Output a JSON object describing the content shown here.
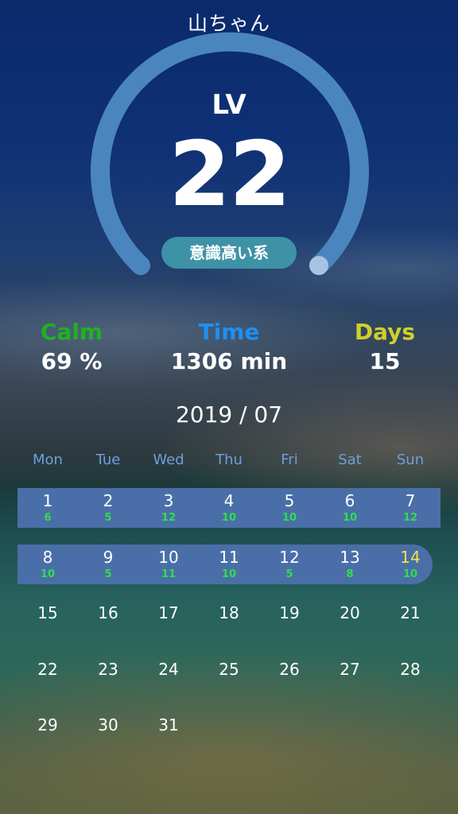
{
  "header": {
    "title": "山ちゃん"
  },
  "level": {
    "label": "LV",
    "value": "22",
    "rank": "意識高い系",
    "progress": 0.95
  },
  "colors": {
    "calm": "#1fb21f",
    "time": "#1c8ff5",
    "days": "#cfcf2c",
    "gauge_track": "#4a86bd",
    "gauge_knob": "#a9c2e2",
    "highlight_row": "#4a6fa8",
    "today": "#f1e44a",
    "session_count": "#2ee04a"
  },
  "stats": {
    "calm": {
      "label": "Calm",
      "value": "69 %"
    },
    "time": {
      "label": "Time",
      "value": "1306 min"
    },
    "days": {
      "label": "Days",
      "value": "15"
    }
  },
  "calendar": {
    "month_label": "2019 / 07",
    "weekdays": [
      "Mon",
      "Tue",
      "Wed",
      "Thu",
      "Fri",
      "Sat",
      "Sun"
    ],
    "weeks": [
      [
        {
          "day": "1",
          "count": "6"
        },
        {
          "day": "2",
          "count": "5"
        },
        {
          "day": "3",
          "count": "12"
        },
        {
          "day": "4",
          "count": "10"
        },
        {
          "day": "5",
          "count": "10"
        },
        {
          "day": "6",
          "count": "10"
        },
        {
          "day": "7",
          "count": "12"
        }
      ],
      [
        {
          "day": "8",
          "count": "10"
        },
        {
          "day": "9",
          "count": "5"
        },
        {
          "day": "10",
          "count": "11"
        },
        {
          "day": "11",
          "count": "10"
        },
        {
          "day": "12",
          "count": "5"
        },
        {
          "day": "13",
          "count": "8"
        },
        {
          "day": "14",
          "count": "10",
          "today": true
        }
      ],
      [
        {
          "day": "15"
        },
        {
          "day": "16"
        },
        {
          "day": "17"
        },
        {
          "day": "18"
        },
        {
          "day": "19"
        },
        {
          "day": "20"
        },
        {
          "day": "21"
        }
      ],
      [
        {
          "day": "22"
        },
        {
          "day": "23"
        },
        {
          "day": "24"
        },
        {
          "day": "25"
        },
        {
          "day": "26"
        },
        {
          "day": "27"
        },
        {
          "day": "28"
        }
      ],
      [
        {
          "day": "29"
        },
        {
          "day": "30"
        },
        {
          "day": "31"
        }
      ]
    ]
  }
}
